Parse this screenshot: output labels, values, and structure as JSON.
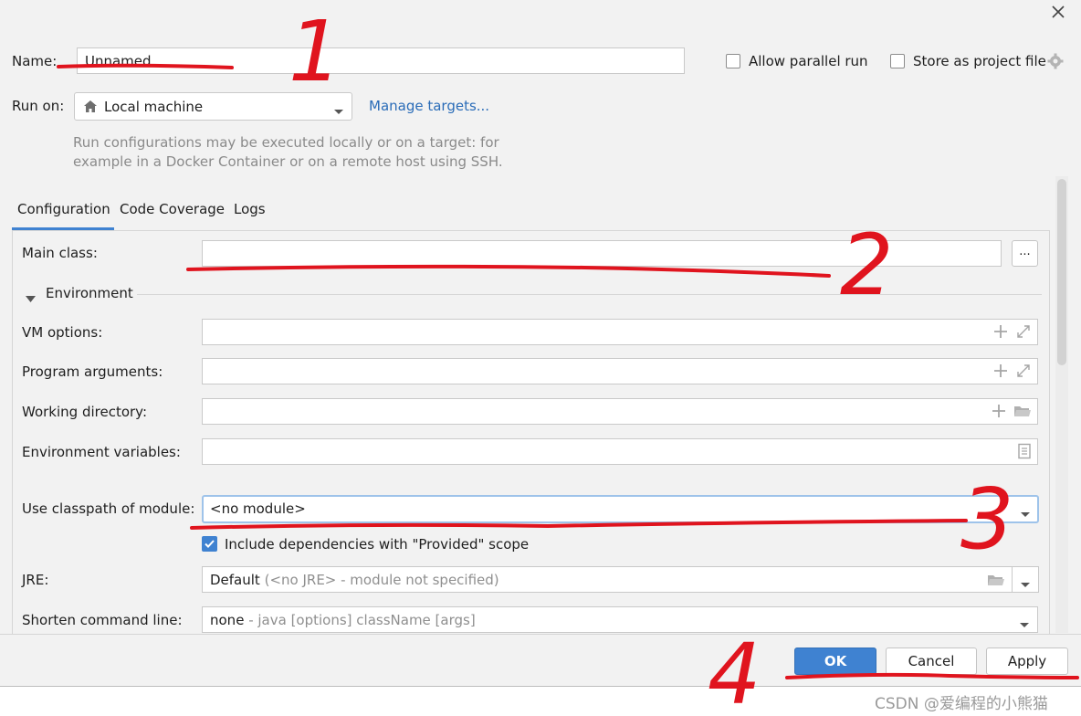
{
  "header": {
    "name_label": "Name:",
    "name_value": "Unnamed",
    "allow_parallel_label": "Allow parallel run",
    "store_project_label": "Store as project file",
    "run_on_label": "Run on:",
    "run_on_value": "Local machine",
    "manage_targets_label": "Manage targets...",
    "hint_line1": "Run configurations may be executed locally or on a target: for",
    "hint_line2": "example in a Docker Container or on a remote host using SSH."
  },
  "tabs": [
    {
      "label": "Configuration",
      "active": true
    },
    {
      "label": "Code Coverage",
      "active": false
    },
    {
      "label": "Logs",
      "active": false
    }
  ],
  "form": {
    "main_class_label": "Main class:",
    "main_class_value": "",
    "browse_label": "...",
    "environment_label": "Environment",
    "vm_options_label": "VM options:",
    "program_args_label": "Program arguments:",
    "working_dir_label": "Working directory:",
    "env_vars_label": "Environment variables:",
    "classpath_label": "Use classpath of module:",
    "classpath_value": "<no module>",
    "include_deps_label": "Include dependencies with \"Provided\" scope",
    "include_deps_checked": true,
    "jre_label": "JRE:",
    "jre_value": "Default",
    "jre_hint": "(<no JRE> - module not specified)",
    "shorten_label": "Shorten command line:",
    "shorten_value": "none",
    "shorten_hint": "- java [options] className [args]"
  },
  "footer": {
    "ok_label": "OK",
    "cancel_label": "Cancel",
    "apply_label": "Apply"
  },
  "watermark": "CSDN @爱编程的小熊猫",
  "annotations": [
    "1",
    "2",
    "3",
    "4"
  ],
  "colors": {
    "accent": "#3f82d1",
    "link": "#2a6cb8",
    "annotation": "#e0141e",
    "background": "#f2f2f2"
  }
}
